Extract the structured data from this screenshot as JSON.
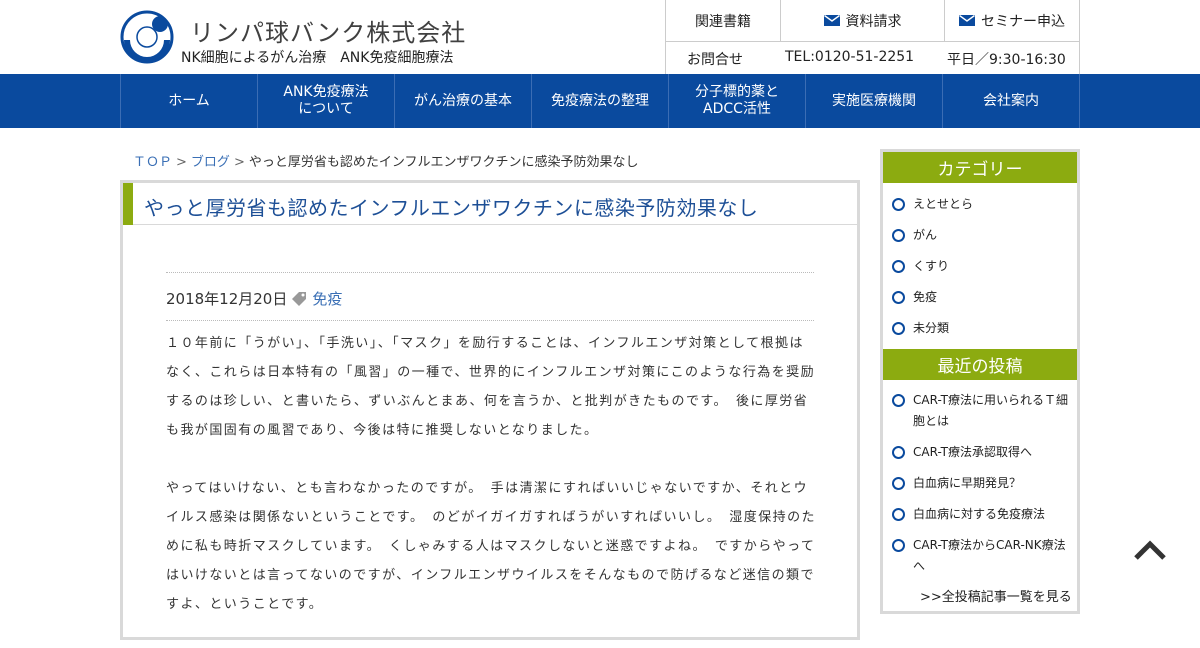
{
  "header": {
    "brand_name": "リンパ球バンク株式会社",
    "tagline": "NK細胞によるがん治療　ANK免疫細胞療法",
    "logo_icon": "company-logo-icon"
  },
  "util": {
    "links": [
      {
        "label": "関連書籍",
        "icon": ""
      },
      {
        "label": "資料請求",
        "icon": "mail-icon"
      },
      {
        "label": "セミナー申込",
        "icon": "mail-icon"
      }
    ],
    "contact": "お問合せ",
    "tel": "TEL:0120-51-2251",
    "hours": "平日／9:30-16:30"
  },
  "nav": {
    "items": [
      "ホーム",
      "ANK免疫療法\nについて",
      "がん治療の基本",
      "免疫療法の整理",
      "分子標的薬と\nADCC活性",
      "実施医療機関",
      "会社案内"
    ]
  },
  "breadcrumb": {
    "top": "ＴＯＰ",
    "sep": ">",
    "blog": "ブログ",
    "current": "やっと厚労省も認めたインフルエンザワクチンに感染予防効果なし"
  },
  "article": {
    "title": "やっと厚労省も認めたインフルエンザワクチンに感染予防効果なし",
    "date": "2018年12月20日",
    "category": "免疫",
    "paragraphs": [
      "１０年前に「うがい」、「手洗い」、「マスク」を励行することは、インフルエンザ対策として根拠はなく、これらは日本特有の「風習」の一種で、世界的にインフルエンザ対策にこのような行為を奨励するのは珍しい、と書いたら、ずいぶんとまあ、何を言うか、と批判がきたものです。　後に厚労省も我が国固有の風習であり、今後は特に推奨しないとなりました。",
      "やってはいけない、とも言わなかったのですが。　手は清潔にすればいいじゃないですか、それとウイルス感染は関係ないということです。　のどがイガイガすればうがいすればいいし。　湿度保持のために私も時折マスクしています。　くしゃみする人はマスクしないと迷惑ですよね。　ですからやってはいけないとは言ってないのですが、インフルエンザウイルスをそんなもので防げるなど迷信の類ですよ、ということです。"
    ]
  },
  "sidebar": {
    "categories_heading": "カテゴリー",
    "categories": [
      "えとせとら",
      "がん",
      "くすり",
      "免疫",
      "未分類"
    ],
    "recent_heading": "最近の投稿",
    "recent": [
      "CAR-T療法に用いられるＴ細胞とは",
      "CAR-T療法承認取得へ",
      "白血病に早期発見？",
      "白血病に対する免疫療法",
      "CAR-T療法からCAR-NK療法へ"
    ],
    "all_posts": ">>全投稿記事一覧を見る"
  },
  "colors": {
    "nav_blue": "#0a4a9e",
    "accent_green": "#8cab10",
    "title_blue": "#1d4f96",
    "link_blue": "#3a6fb5"
  }
}
